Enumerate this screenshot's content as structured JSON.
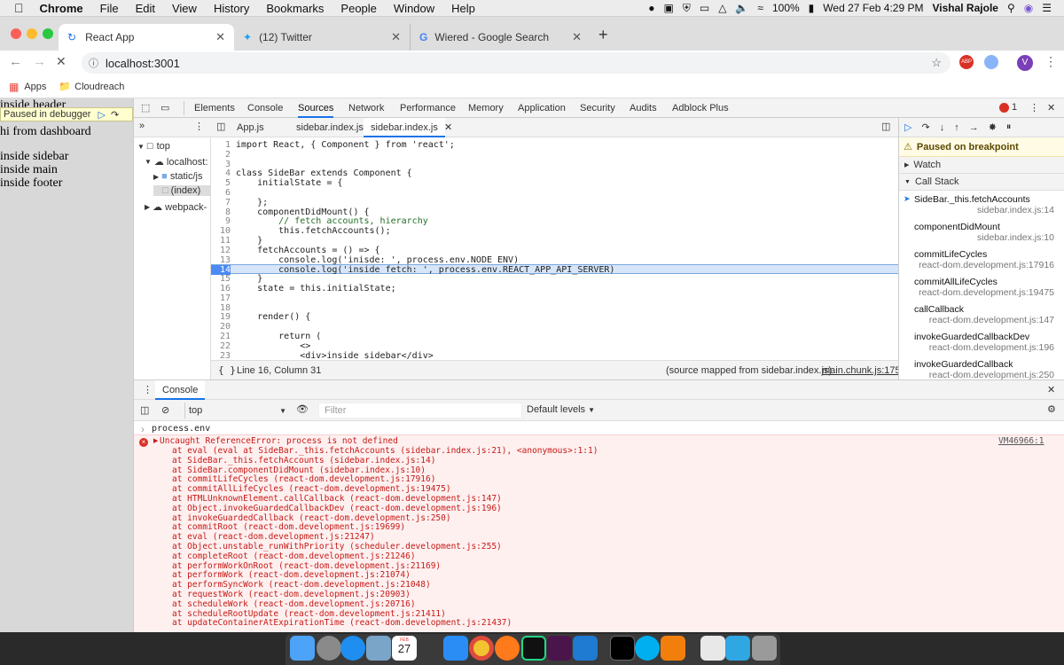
{
  "menubar": {
    "items": [
      "Chrome",
      "File",
      "Edit",
      "View",
      "History",
      "Bookmarks",
      "People",
      "Window",
      "Help"
    ],
    "battery": "100%",
    "datetime": "Wed 27 Feb  4:29 PM",
    "user": "Vishal Rajole"
  },
  "tabs": [
    {
      "title": "React App"
    },
    {
      "title": "(12) Twitter"
    },
    {
      "title": "Wiered - Google Search"
    }
  ],
  "address": {
    "url": "localhost:3001",
    "avatar": "V"
  },
  "bookmarks": {
    "apps": "Apps",
    "folder": "Cloudreach"
  },
  "page": {
    "paused_label": "Paused in debugger",
    "lines": [
      "inside header",
      "hi from dashboard",
      "",
      "inside sidebar",
      "inside main",
      "inside footer"
    ]
  },
  "devtools": {
    "tabs": [
      "Elements",
      "Console",
      "Sources",
      "Network",
      "Performance",
      "Memory",
      "Application",
      "Security",
      "Audits",
      "Adblock Plus"
    ],
    "error_count": "1",
    "navigator": [
      "top",
      "localhost:",
      "static/js",
      "(index)",
      "webpack-"
    ],
    "file_tabs": [
      "App.js",
      "sidebar.index.js",
      "sidebar.index.js"
    ],
    "code": [
      {
        "n": "1",
        "t": "import React, { Component } from 'react';"
      },
      {
        "n": "2",
        "t": ""
      },
      {
        "n": "3",
        "t": ""
      },
      {
        "n": "4",
        "t": "class SideBar extends Component {"
      },
      {
        "n": "5",
        "t": "    initialState = {"
      },
      {
        "n": "6",
        "t": ""
      },
      {
        "n": "7",
        "t": "    };"
      },
      {
        "n": "8",
        "t": "    componentDidMount() {"
      },
      {
        "n": "9",
        "t": "        // fetch accounts, hierarchy"
      },
      {
        "n": "10",
        "t": "        this.fetchAccounts();"
      },
      {
        "n": "11",
        "t": "    }"
      },
      {
        "n": "12",
        "t": "    fetchAccounts = () => {"
      },
      {
        "n": "13",
        "t": "        console.log('inisde: ', process.env.NODE_ENV)"
      },
      {
        "n": "14",
        "t": "        console.log('inside fetch: ', process.env.REACT_APP_API_SERVER)"
      },
      {
        "n": "15",
        "t": "    }"
      },
      {
        "n": "16",
        "t": "    state = this.initialState;"
      },
      {
        "n": "17",
        "t": ""
      },
      {
        "n": "18",
        "t": ""
      },
      {
        "n": "19",
        "t": "    render() {"
      },
      {
        "n": "20",
        "t": ""
      },
      {
        "n": "21",
        "t": "        return ("
      },
      {
        "n": "22",
        "t": "            <>"
      },
      {
        "n": "23",
        "t": "            <div>inside sidebar</div>"
      }
    ],
    "status_position": "Line 16, Column 31",
    "source_mapped": "(source mapped from sidebar.index.js)",
    "source_link": "main.chunk.js:175",
    "debugger": {
      "paused": "Paused on breakpoint",
      "watch": "Watch",
      "call_stack": "Call Stack",
      "frames": [
        {
          "fn": "SideBar._this.fetchAccounts",
          "loc": "sidebar.index.js:14"
        },
        {
          "fn": "componentDidMount",
          "loc": "sidebar.index.js:10"
        },
        {
          "fn": "commitLifeCycles",
          "loc": "react-dom.development.js:17916"
        },
        {
          "fn": "commitAllLifeCycles",
          "loc": "react-dom.development.js:19475"
        },
        {
          "fn": "callCallback",
          "loc": "react-dom.development.js:147"
        },
        {
          "fn": "invokeGuardedCallbackDev",
          "loc": "react-dom.development.js:196"
        },
        {
          "fn": "invokeGuardedCallback",
          "loc": "react-dom.development.js:250"
        }
      ]
    }
  },
  "console": {
    "title": "Console",
    "context": "top",
    "filter_placeholder": "Filter",
    "levels": "Default levels",
    "input": "process.env",
    "error_head": "Uncaught ReferenceError: process is not defined",
    "error_source": "VM46966:1",
    "stack": [
      "at eval (eval at SideBar._this.fetchAccounts (sidebar.index.js:21), <anonymous>:1:1)",
      "at SideBar._this.fetchAccounts (sidebar.index.js:14)",
      "at SideBar.componentDidMount (sidebar.index.js:10)",
      "at commitLifeCycles (react-dom.development.js:17916)",
      "at commitAllLifeCycles (react-dom.development.js:19475)",
      "at HTMLUnknownElement.callCallback (react-dom.development.js:147)",
      "at Object.invokeGuardedCallbackDev (react-dom.development.js:196)",
      "at invokeGuardedCallback (react-dom.development.js:250)",
      "at commitRoot (react-dom.development.js:19699)",
      "at eval (react-dom.development.js:21247)",
      "at Object.unstable_runWithPriority (scheduler.development.js:255)",
      "at completeRoot (react-dom.development.js:21246)",
      "at performWorkOnRoot (react-dom.development.js:21169)",
      "at performWork (react-dom.development.js:21074)",
      "at performSyncWork (react-dom.development.js:21048)",
      "at requestWork (react-dom.development.js:20903)",
      "at scheduleWork (react-dom.development.js:20716)",
      "at scheduleRootUpdate (react-dom.development.js:21411)",
      "at updateContainerAtExpirationTime (react-dom.development.js:21437)"
    ]
  },
  "dock": {
    "calendar_day": "27",
    "calendar_month": "FEB"
  }
}
